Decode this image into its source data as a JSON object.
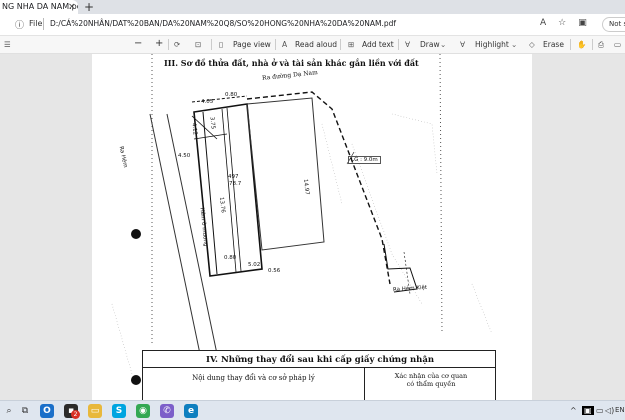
{
  "browser": {
    "tab_title": "NG NHA DA NAM.pdf",
    "tab_close": "×",
    "new_tab": "+",
    "file_label": "File",
    "url": "D:/CÁ%20NHÂN/DAT%20BAN/DA%20NAM%20Q8/SO%20HONG%20NHA%20DA%20NAM.pdf",
    "not_signed": "Not s"
  },
  "pdf_toolbar": {
    "zoom_out": "−",
    "zoom_in": "+",
    "page_view": "Page view",
    "read_aloud": "Read aloud",
    "add_text": "Add text",
    "draw": "Draw",
    "highlight": "Highlight",
    "erase": "Erase"
  },
  "document": {
    "section3_heading": "III. Sơ đồ thửa đất, nhà ở và tài sản khác gắn liền với đất",
    "road_top": "Ra đường Dạ Nam",
    "road_left": "Ra Hẻm",
    "alley_label": "Hẻm ờ mương",
    "lg_label": "LG : 9.0m",
    "road_bottom_right": "Ra Hẻm Kiệt",
    "lot_number": "497",
    "lot_area": "78.7",
    "dims": [
      "4.05",
      "0.80",
      "4.50",
      "5.02",
      "0.56",
      "14.97",
      "13.76",
      "3.75",
      "4.12",
      "0.80"
    ],
    "section4_heading": "IV. Những thay đổi sau khi cấp giấy chứng nhận",
    "col1_header": "Nội dung thay đổi và cơ sở pháp lý",
    "col2_header_line1": "Xác nhận của cơ quan",
    "col2_header_line2": "có thẩm quyền"
  },
  "taskbar": {
    "badge_count": "2",
    "lang": "ENG"
  }
}
